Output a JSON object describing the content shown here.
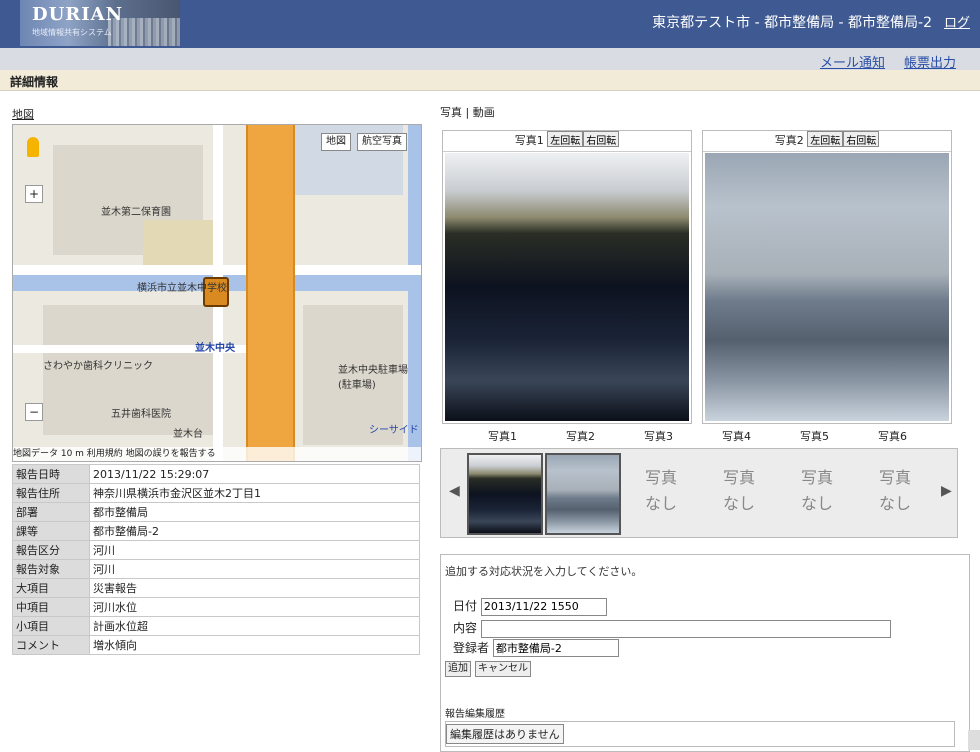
{
  "header": {
    "logo": "DURIAN",
    "logo_sub": "地域情報共有システム",
    "title": "東京都テスト市 - 都市整備局 - 都市整備局-2",
    "logout": "ログ"
  },
  "toplinks": {
    "mail": "メール通知",
    "print": "帳票出力"
  },
  "section_title": "詳細情報",
  "map": {
    "label": "地図",
    "btn_map": "地図",
    "btn_sat": "航空写真",
    "zoom_in": "+",
    "zoom_out": "−",
    "labels": [
      "並木第二保育園",
      "横浜市立並木中学校",
      "並木中央",
      "さわやか歯科クリニック",
      "五井歯科医院",
      "並木中央駐車場(駐車場)",
      "並木台",
      "シーサイド"
    ],
    "footer": "地図データ 10 m  利用規約  地図の誤りを報告する"
  },
  "info_rows": [
    {
      "k": "報告日時",
      "v": "2013/11/22 15:29:07"
    },
    {
      "k": "報告住所",
      "v": "神奈川県横浜市金沢区並木2丁目1"
    },
    {
      "k": "部署",
      "v": "都市整備局"
    },
    {
      "k": "課等",
      "v": "都市整備局-2"
    },
    {
      "k": "報告区分",
      "v": "河川"
    },
    {
      "k": "報告対象",
      "v": "河川"
    },
    {
      "k": "大項目",
      "v": "災害報告"
    },
    {
      "k": "中項目",
      "v": "河川水位"
    },
    {
      "k": "小項目",
      "v": "計画水位超"
    },
    {
      "k": "コメント",
      "v": "増水傾向"
    }
  ],
  "photo_tabs": "写真 | 動画",
  "photos": [
    {
      "title": "写真1",
      "rot_left": "左回転",
      "rot_right": "右回転"
    },
    {
      "title": "写真2",
      "rot_left": "左回転",
      "rot_right": "右回転"
    }
  ],
  "thumb_labels": [
    "写真1",
    "写真2",
    "写真3",
    "写真4",
    "写真5",
    "写真6"
  ],
  "thumb_empty": "写真\nなし",
  "form": {
    "prompt": "追加する対応状況を入力してください。",
    "date_label": "日付",
    "date_value": "2013/11/22 1550",
    "content_label": "内容",
    "content_value": "",
    "reg_label": "登録者",
    "reg_value": "都市整備局-2",
    "add_btn": "追加",
    "cancel_btn": "キャンセル",
    "history_label": "報告編集履歴",
    "history_text": "編集履歴はありません"
  }
}
